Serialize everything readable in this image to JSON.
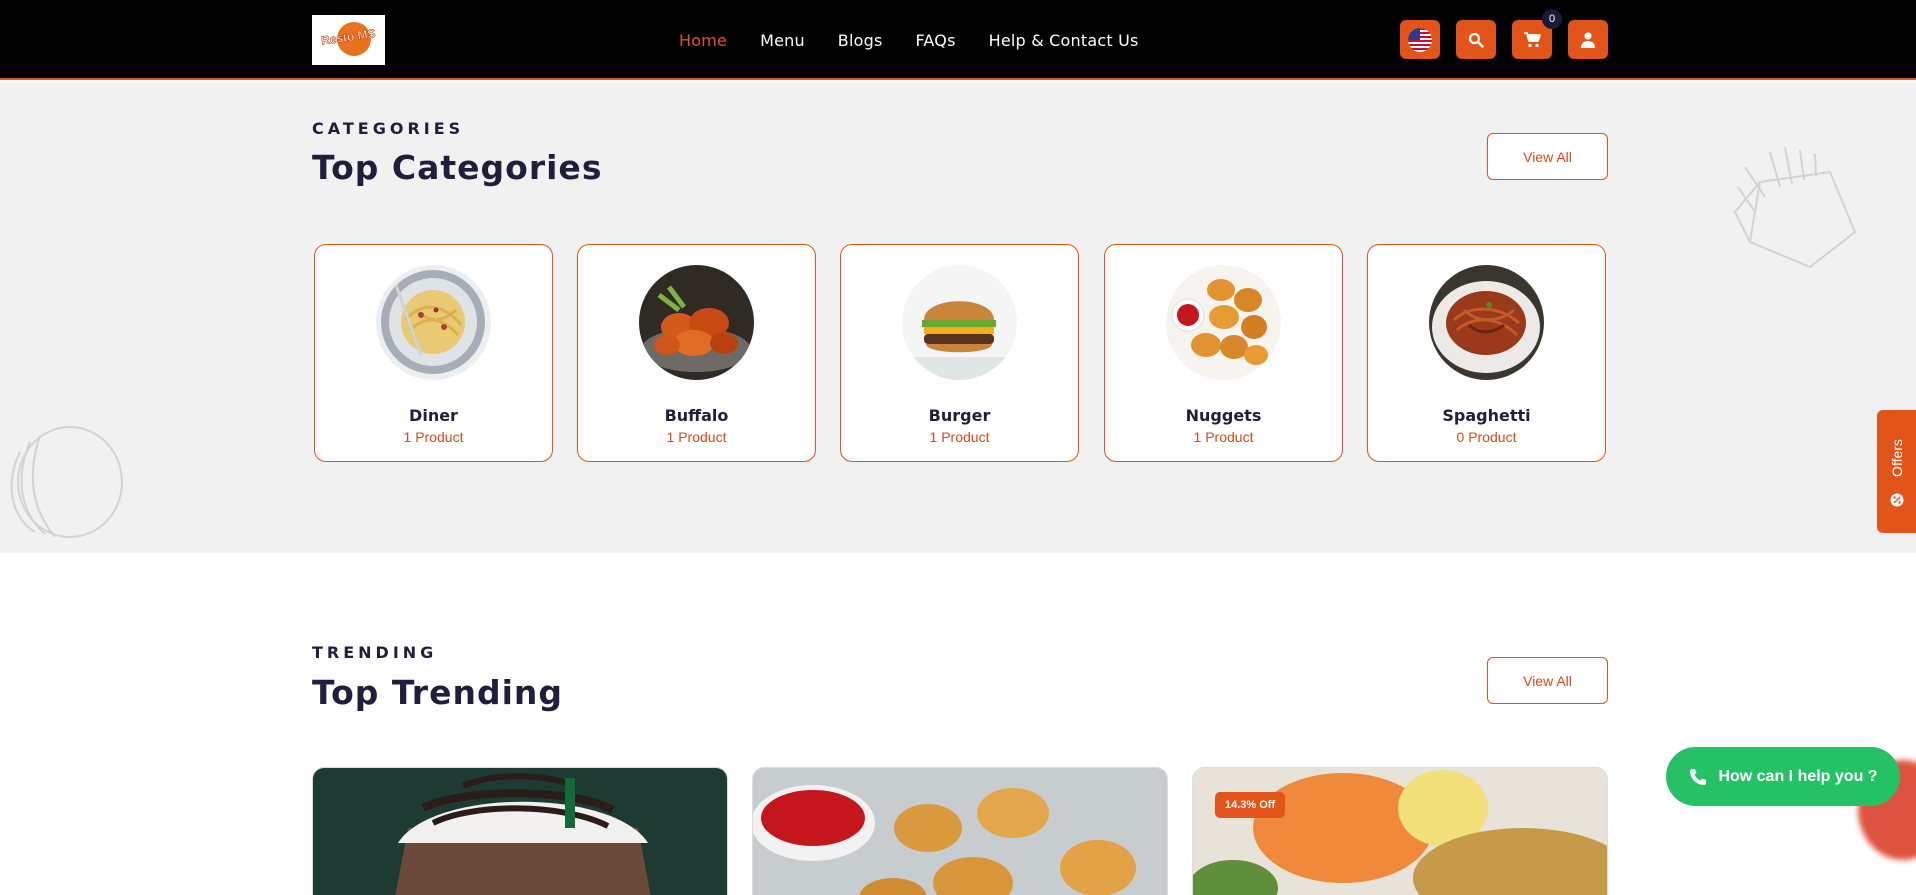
{
  "header": {
    "logo_text": "Resto MS",
    "nav": [
      {
        "label": "Home",
        "active": true
      },
      {
        "label": "Menu"
      },
      {
        "label": "Blogs"
      },
      {
        "label": "FAQs"
      },
      {
        "label": "Help & Contact Us"
      }
    ],
    "cart_count": "0",
    "icons": [
      "us-flag-icon",
      "search-icon",
      "cart-icon",
      "user-icon"
    ],
    "accent_color": "#e2541a"
  },
  "categories": {
    "eyebrow": "CATEGORIES",
    "title": "Top Categories",
    "view_all": "View All",
    "items": [
      {
        "name": "Diner",
        "count": "1 Product"
      },
      {
        "name": "Buffalo",
        "count": "1 Product"
      },
      {
        "name": "Burger",
        "count": "1 Product"
      },
      {
        "name": "Nuggets",
        "count": "1 Product"
      },
      {
        "name": "Spaghetti",
        "count": "0 Product"
      }
    ]
  },
  "trending": {
    "eyebrow": "TRENDING",
    "title": "Top Trending",
    "view_all": "View All",
    "discount_badge": "14.3% Off"
  },
  "widgets": {
    "offers": "Offers",
    "help": "How can I help you ?",
    "help_color": "#25c265"
  }
}
